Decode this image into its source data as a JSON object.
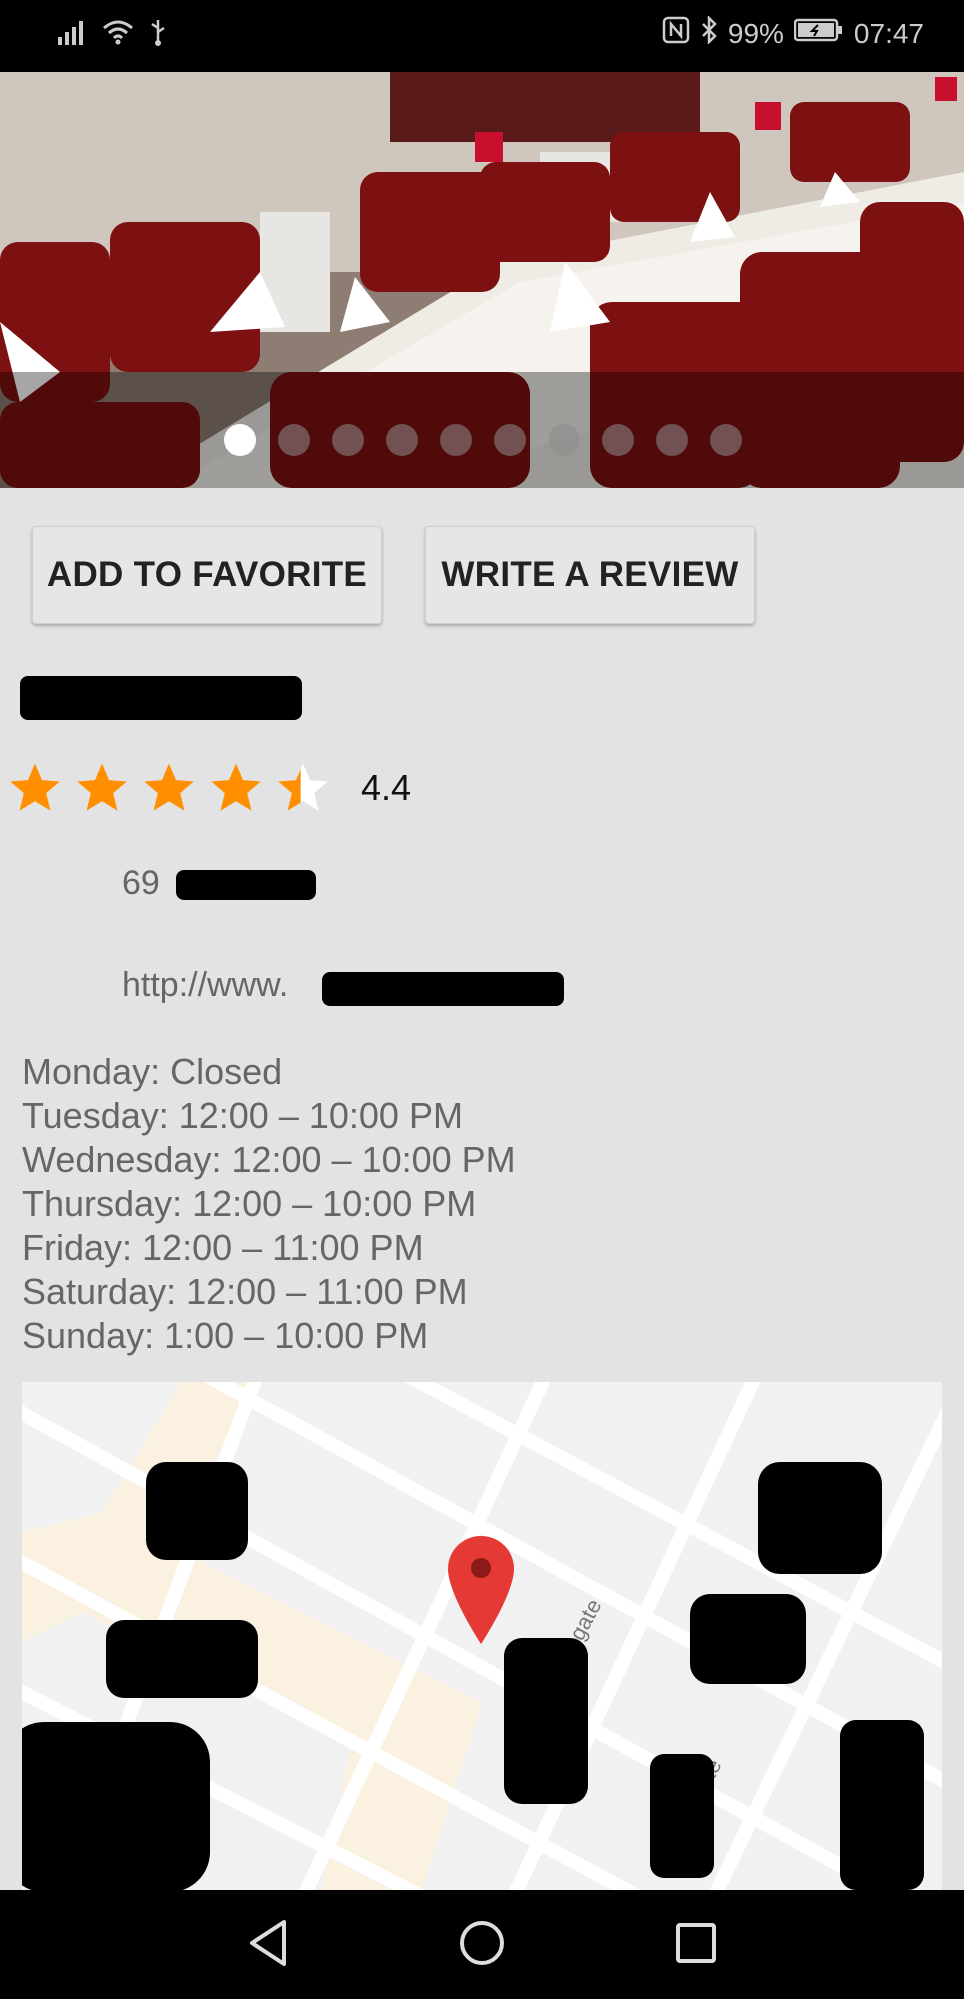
{
  "status_bar": {
    "battery": "99%",
    "time": "07:47"
  },
  "gallery": {
    "slide_count": 10,
    "active_index": 0
  },
  "actions": {
    "add_favorite_label": "ADD TO FAVORITE",
    "write_review_label": "WRITE A REVIEW"
  },
  "place": {
    "rating_value": "4.4",
    "rating": 4.4,
    "address_prefix": "69",
    "website_prefix": "http://www."
  },
  "hours": [
    "Monday: Closed",
    "Tuesday: 12:00 – 10:00 PM",
    "Wednesday: 12:00 – 10:00 PM",
    "Thursday: 12:00 – 10:00 PM",
    "Friday: 12:00 – 11:00 PM",
    "Saturday: 12:00 – 11:00 PM",
    "Sunday: 1:00 – 10:00 PM"
  ],
  "map": {
    "street_label_1": "gate",
    "street_label_2": "gate",
    "marker_color": "#e53935"
  },
  "colors": {
    "star": "#ff8f00",
    "background": "#e3e3e3"
  }
}
